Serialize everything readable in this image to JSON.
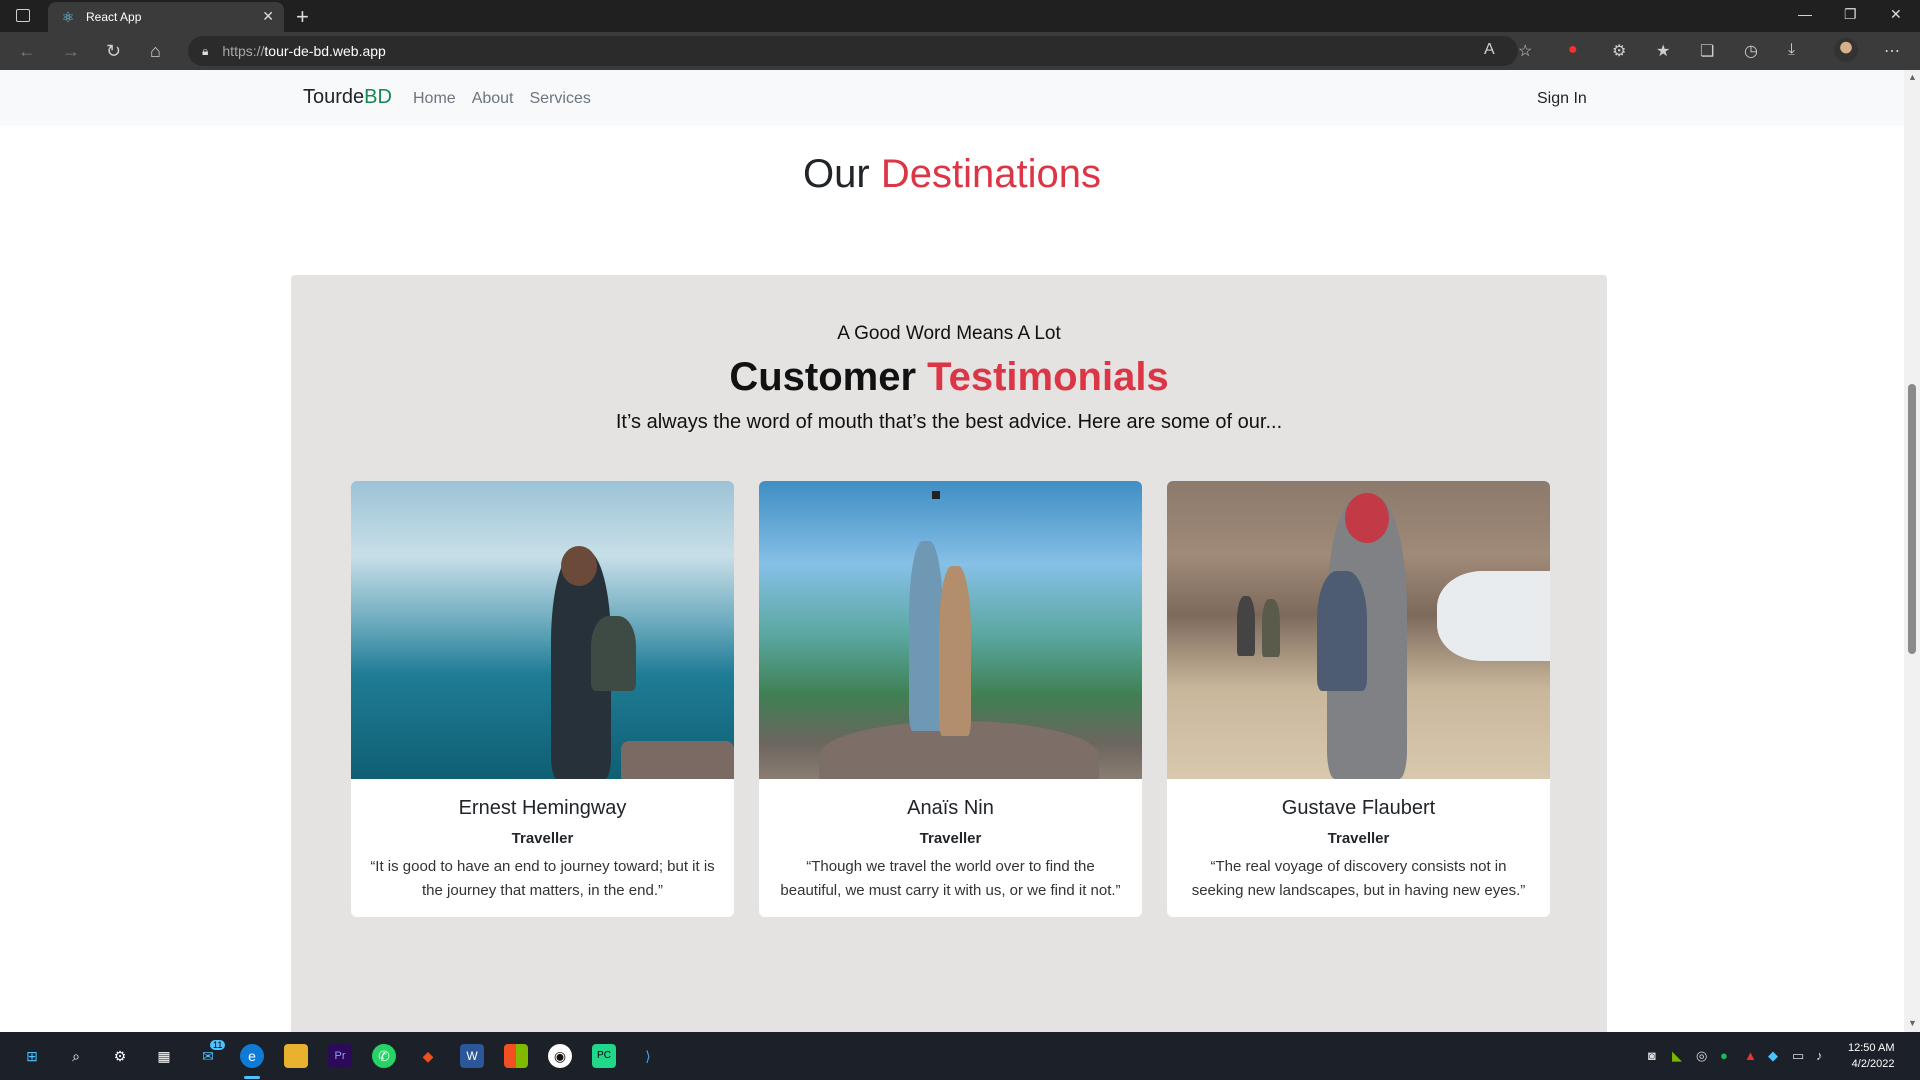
{
  "browser": {
    "tab_title": "React App",
    "url_protocol": "https://",
    "url_host": "tour-de-bd.web.app"
  },
  "nav": {
    "brand_part1": "Tourde",
    "brand_part2": "BD",
    "links": [
      "Home",
      "About",
      "Services"
    ],
    "sign_in": "Sign In"
  },
  "destinations": {
    "title_part1": "Our",
    "title_part2": "Destinations"
  },
  "testimonials": {
    "small_heading": "A Good Word Means A Lot",
    "title_part1": "Customer",
    "title_part2": "Testimonials",
    "subtitle": "It’s always the word of mouth that’s the best advice. Here are some of our...",
    "cards": [
      {
        "name": "Ernest Hemingway",
        "role": "Traveller",
        "quote": "“It is good to have an end to journey toward; but it is the journey that matters, in the end.”"
      },
      {
        "name": "Anaïs Nin",
        "role": "Traveller",
        "quote": "“Though we travel the world over to find the beautiful, we must carry it with us, or we find it not.”"
      },
      {
        "name": "Gustave Flaubert",
        "role": "Traveller",
        "quote": "“The real voyage of discovery consists not in seeking new landscapes, but in having new eyes.”"
      }
    ]
  },
  "taskbar": {
    "time": "12:50 AM",
    "date": "4/2/2022",
    "mail_badge": "11"
  },
  "colors": {
    "accent_red": "#dc3545",
    "brand_green": "#198754",
    "testimonial_bg": "#e5e3e2"
  }
}
